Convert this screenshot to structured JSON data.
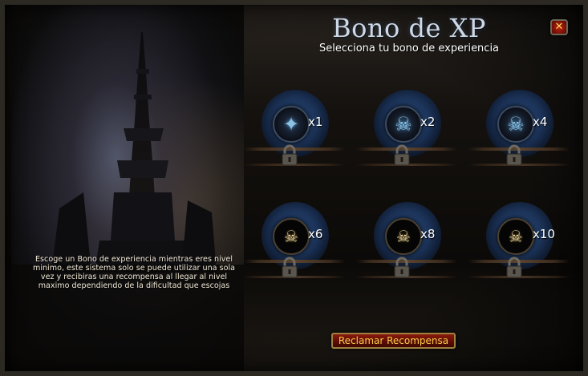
{
  "window": {
    "title": "Bono de XP",
    "subtitle": "Selecciona tu bono de experiencia",
    "close_icon": "close-icon",
    "close_glyph": "✕"
  },
  "sidebar": {
    "description": "Escoge un Bono de experiencia mientras eres nivel minimo, este sistema solo se puede utilizar una sola vez y recibiras una recompensa al llegar al nivel maximo dependiendo de la dificultad que escojas"
  },
  "bonuses": [
    {
      "label": "x1",
      "icon": "blue-skull-spiked-icon",
      "locked": true
    },
    {
      "label": "x2",
      "icon": "blue-skull-icon",
      "locked": true
    },
    {
      "label": "x4",
      "icon": "blue-skull-icon",
      "locked": true
    },
    {
      "label": "x6",
      "icon": "bone-skull-icon",
      "locked": true
    },
    {
      "label": "x8",
      "icon": "bone-skull-icon",
      "locked": true
    },
    {
      "label": "x10",
      "icon": "bone-skull-icon",
      "locked": true
    }
  ],
  "footer": {
    "claim_label": "Reclamar Recompensa"
  },
  "colors": {
    "title": "#cfd9e6",
    "button_text": "#f5cf4a",
    "button_bg": "#6a0e06"
  }
}
